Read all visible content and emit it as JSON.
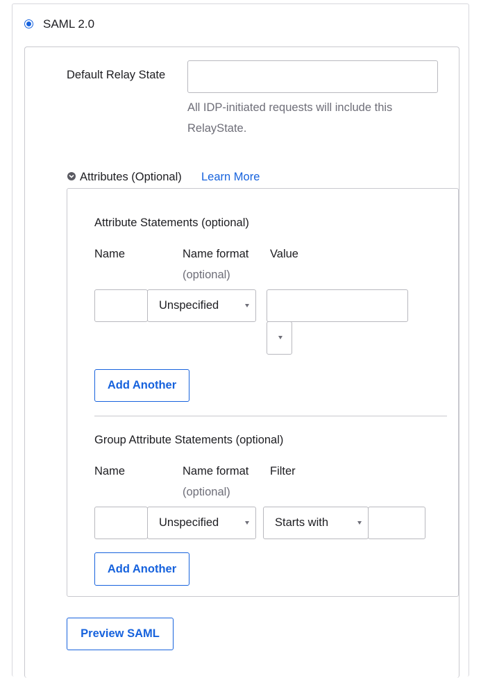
{
  "saml_option": {
    "label": "SAML 2.0",
    "selected": true
  },
  "relay_state": {
    "label": "Default Relay State",
    "value": "",
    "hint_line1": "All IDP-initiated requests will include this",
    "hint_line2": "RelayState."
  },
  "attributes_section": {
    "title": "Attributes (Optional)",
    "learn_more": "Learn More"
  },
  "attribute_statements": {
    "title": "Attribute Statements (optional)",
    "col_name": "Name",
    "col_name_format": "Name format",
    "col_name_format_hint": "(optional)",
    "col_value": "Value",
    "row": {
      "name": "",
      "format": "Unspecified",
      "value": ""
    },
    "add_button": "Add Another"
  },
  "group_attribute_statements": {
    "title": "Group Attribute Statements (optional)",
    "col_name": "Name",
    "col_name_format": "Name format",
    "col_name_format_hint": "(optional)",
    "col_filter": "Filter",
    "row": {
      "name": "",
      "format": "Unspecified",
      "filter": "Starts with",
      "filter_value": ""
    },
    "add_button": "Add Another"
  },
  "preview_button": "Preview SAML",
  "colors": {
    "accent": "#1662dd",
    "border": "#c8c8ce",
    "hint_text": "#6e6e78"
  }
}
